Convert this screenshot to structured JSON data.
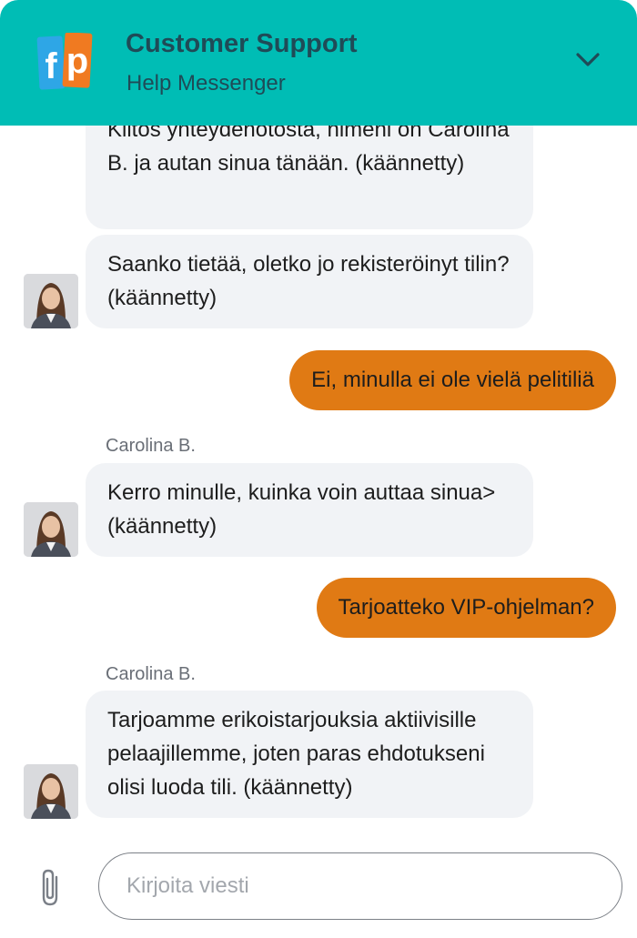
{
  "header": {
    "title": "Customer Support",
    "subtitle": "Help Messenger",
    "logo_text": "fp"
  },
  "messages": [
    {
      "from": "agent",
      "text": "Kiitos yhteydenotosta, nimeni on Carolina B. ja autan sinua tänään. (käännetty)"
    },
    {
      "from": "agent",
      "text": "Saanko tietää, oletko jo rekisteröinyt tilin? (käännetty)"
    },
    {
      "from": "user",
      "text": "Ei, minulla ei ole vielä pelitiliä"
    },
    {
      "from": "agent",
      "sender": "Carolina B.",
      "text": "Kerro minulle, kuinka voin auttaa sinua> (käännetty)"
    },
    {
      "from": "user",
      "text": "Tarjoatteko VIP-ohjelman?"
    },
    {
      "from": "agent",
      "sender": "Carolina B.",
      "text": "Tarjoamme erikoistarjouksia aktiivisille pelaajillemme, joten paras ehdotukseni olisi luoda tili. (käännetty)"
    }
  ],
  "composer": {
    "placeholder": "Kirjoita viesti"
  },
  "colors": {
    "header": "#00bdb5",
    "header_text": "#1f4b57",
    "user_bubble": "#e07a14",
    "agent_bubble": "#f1f3f6",
    "logo_blue": "#2ea6e6",
    "logo_orange": "#f07a21"
  },
  "icons": {
    "collapse": "chevron-down-icon",
    "attach": "paperclip-icon"
  }
}
